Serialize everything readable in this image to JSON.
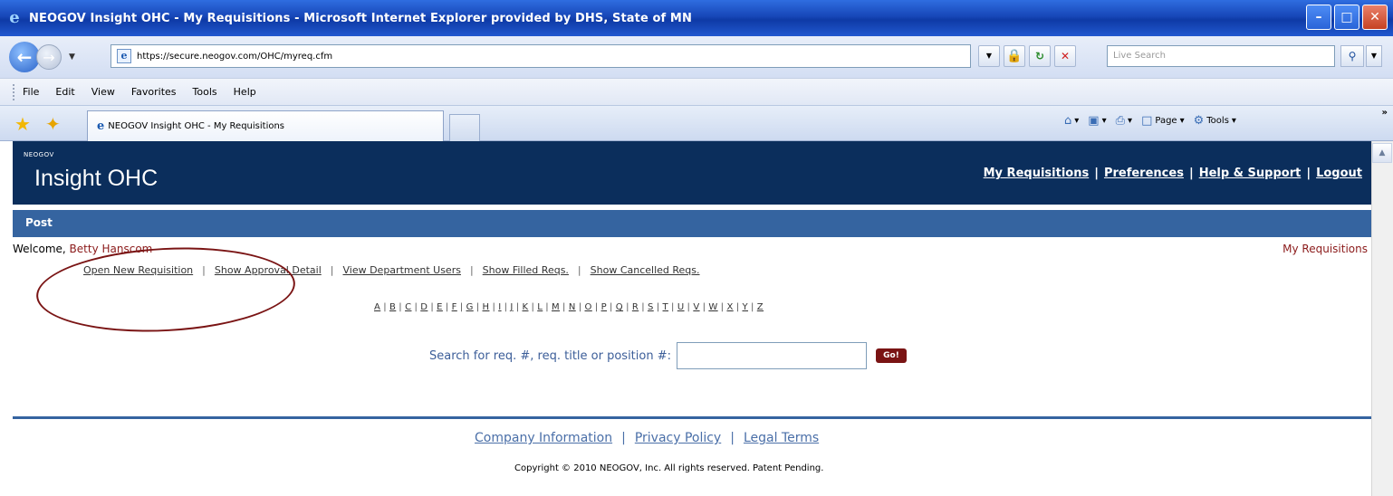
{
  "window": {
    "title": "NEOGOV Insight OHC - My Requisitions - Microsoft Internet Explorer provided by DHS, State of MN",
    "buttons": {
      "minimize": "–",
      "maximize": "□",
      "close": "✕"
    }
  },
  "address_bar": {
    "url": "https://secure.neogov.com/OHC/myreq.cfm",
    "search_placeholder": "Live Search"
  },
  "menu": [
    "File",
    "Edit",
    "View",
    "Favorites",
    "Tools",
    "Help"
  ],
  "tabs": {
    "active_label": "NEOGOV Insight OHC - My Requisitions"
  },
  "command_bar": {
    "page_label": "Page",
    "tools_label": "Tools"
  },
  "site": {
    "brand_small": "NEOGOV",
    "brand_main": "Insight OHC",
    "nav": [
      "My Requisitions",
      "Preferences",
      "Help & Support",
      "Logout"
    ],
    "subnav_title": "Post",
    "welcome_prefix": "Welcome,",
    "user_name": "Betty Hanscom",
    "my_requisitions_link": "My Requisitions",
    "actions": [
      "Open New Requisition",
      "Show Approval Detail",
      "View Department Users",
      "Show Filled Reqs.",
      "Show Cancelled Reqs."
    ],
    "alphabet": [
      "A",
      "B",
      "C",
      "D",
      "E",
      "F",
      "G",
      "H",
      "I",
      "J",
      "K",
      "L",
      "M",
      "N",
      "O",
      "P",
      "Q",
      "R",
      "S",
      "T",
      "U",
      "V",
      "W",
      "X",
      "Y",
      "Z"
    ],
    "search_label": "Search for req. #, req. title or position #:",
    "search_value": "",
    "go_label": "Go!",
    "footer_links": [
      "Company Information",
      "Privacy Policy",
      "Legal Terms"
    ],
    "copyright": "Copyright © 2010 NEOGOV, Inc. All rights reserved. Patent Pending."
  },
  "colors": {
    "header_bg": "#0b2e5c",
    "subnav_bg": "#3564a0",
    "accent_maroon": "#7a1414"
  }
}
